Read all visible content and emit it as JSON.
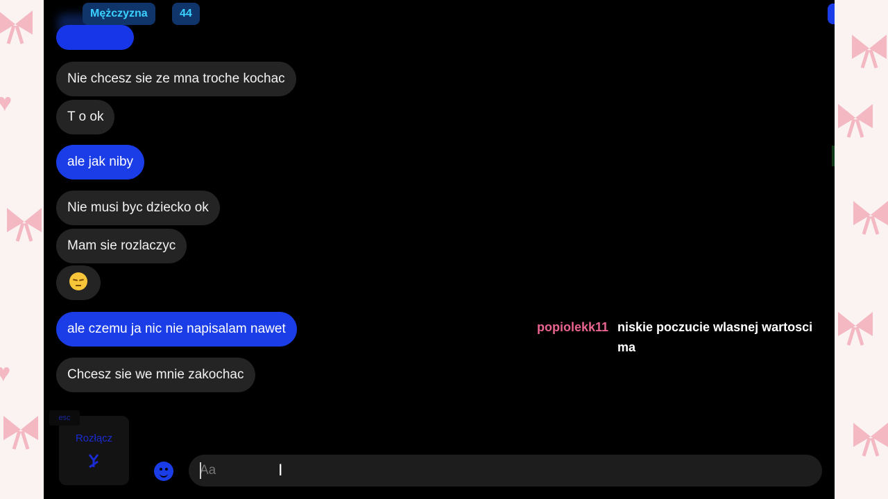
{
  "header": {
    "gender_badge": "Mężczyzna",
    "age_badge": "44"
  },
  "messages": [
    {
      "text": "Nie chcesz sie ze mna troche kochac",
      "side": "in"
    },
    {
      "text": "T o ok",
      "side": "in"
    },
    {
      "text": "ale jak niby",
      "side": "out"
    },
    {
      "text": "Nie musi byc dziecko ok",
      "side": "in"
    },
    {
      "text": "Mam sie rozlaczyc",
      "side": "in"
    },
    {
      "text": "",
      "side": "in",
      "emoji": "pensive-face"
    },
    {
      "text": "ale czemu ja nic nie napisalam nawet",
      "side": "out"
    },
    {
      "text": "Chcesz sie we mnie zakochac",
      "side": "in"
    }
  ],
  "overlay_chat": {
    "username": "popiolekk11",
    "text": "niskie poczucie wlasnej wartosci ma",
    "username_color": "#e9648e"
  },
  "footer": {
    "esc_key": "esc",
    "disconnect_label": "Rozłącz",
    "input_placeholder": "Aa"
  },
  "colors": {
    "outgoing_bubble": "#1a3de8",
    "incoming_bubble": "#242424",
    "badge_bg": "#10356b",
    "badge_text": "#3ad1ff"
  }
}
